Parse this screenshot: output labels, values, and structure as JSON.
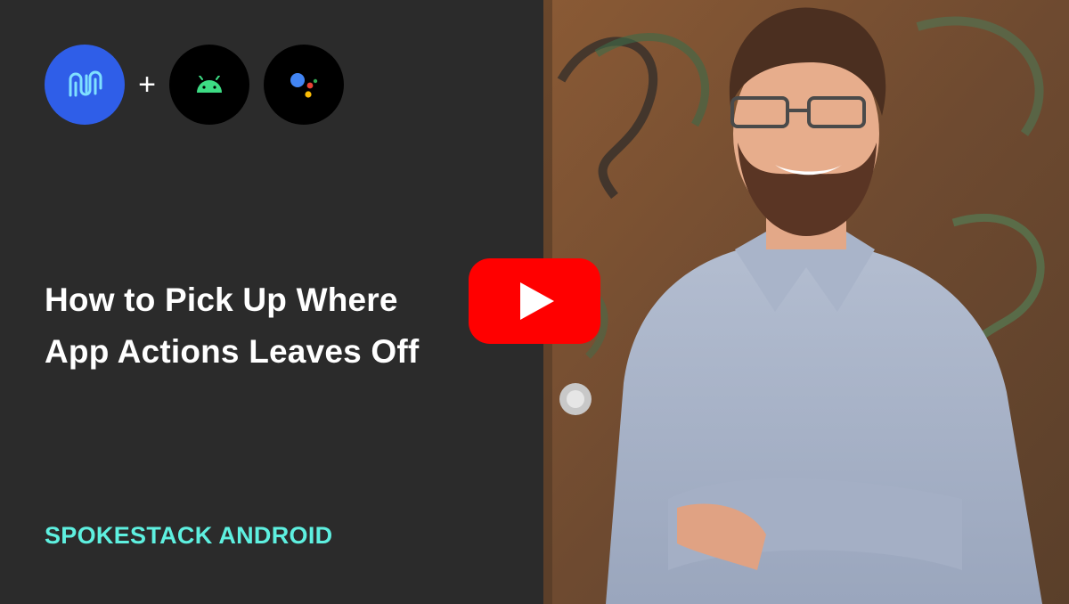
{
  "thumbnail": {
    "title_lines": [
      "How to Pick Up Where",
      "App Actions Leaves Off"
    ],
    "series_label": "SPOKESTACK ANDROID",
    "plus_symbol": "+"
  },
  "logos": [
    {
      "name": "spokestack-logo",
      "bg": "#2f5ee8"
    },
    {
      "name": "android-logo",
      "bg": "#000000"
    },
    {
      "name": "google-assistant-logo",
      "bg": "#000000"
    }
  ],
  "play_button": {
    "icon": "youtube-play-icon",
    "color": "#ff0000"
  },
  "colors": {
    "background": "#2b2b2b",
    "title": "#ffffff",
    "series_label": "#5ef0e0",
    "spokestack_blue": "#2f5ee8",
    "android_green": "#3ddc84"
  }
}
